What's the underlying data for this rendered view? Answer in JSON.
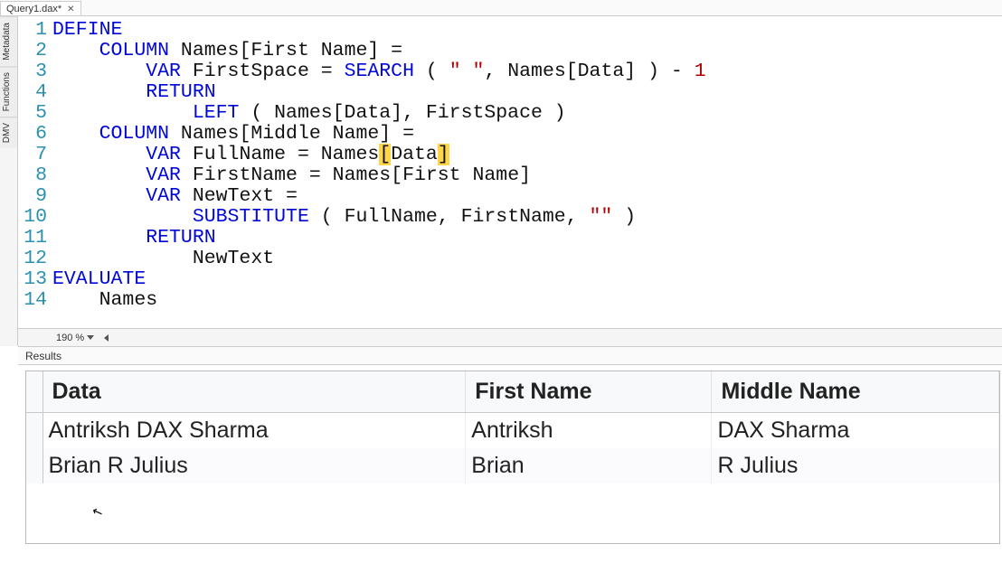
{
  "tab": {
    "title": "Query1.dax*"
  },
  "side_tabs": [
    "Metadata",
    "Functions",
    "DMV"
  ],
  "zoom": {
    "label": "190 %"
  },
  "code": {
    "lines": [
      [
        {
          "t": "DEFINE",
          "c": "kw"
        }
      ],
      [
        {
          "t": "    "
        },
        {
          "t": "COLUMN",
          "c": "kw"
        },
        {
          "t": " Names[First Name] ="
        }
      ],
      [
        {
          "t": "        "
        },
        {
          "t": "VAR",
          "c": "kw"
        },
        {
          "t": " FirstSpace = "
        },
        {
          "t": "SEARCH",
          "c": "fn"
        },
        {
          "t": " ( "
        },
        {
          "t": "\" \"",
          "c": "str"
        },
        {
          "t": ", Names[Data] ) - "
        },
        {
          "t": "1",
          "c": "num"
        }
      ],
      [
        {
          "t": "        "
        },
        {
          "t": "RETURN",
          "c": "kw"
        }
      ],
      [
        {
          "t": "            "
        },
        {
          "t": "LEFT",
          "c": "fn"
        },
        {
          "t": " ( Names[Data], FirstSpace )"
        }
      ],
      [
        {
          "t": "    "
        },
        {
          "t": "COLUMN",
          "c": "kw"
        },
        {
          "t": " Names[Middle Name] ="
        }
      ],
      [
        {
          "t": "        "
        },
        {
          "t": "VAR",
          "c": "kw"
        },
        {
          "t": " FullName = Names"
        },
        {
          "t": "[",
          "c": "hl"
        },
        {
          "t": "Data"
        },
        {
          "t": "]",
          "c": "hl"
        }
      ],
      [
        {
          "t": "        "
        },
        {
          "t": "VAR",
          "c": "kw"
        },
        {
          "t": " FirstName = Names[First Name]"
        }
      ],
      [
        {
          "t": "        "
        },
        {
          "t": "VAR",
          "c": "kw"
        },
        {
          "t": " NewText ="
        }
      ],
      [
        {
          "t": "            "
        },
        {
          "t": "SUBSTITUTE",
          "c": "fn"
        },
        {
          "t": " ( FullName, FirstName, "
        },
        {
          "t": "\"\"",
          "c": "str"
        },
        {
          "t": " )"
        }
      ],
      [
        {
          "t": "        "
        },
        {
          "t": "RETURN",
          "c": "kw"
        }
      ],
      [
        {
          "t": "            NewText"
        }
      ],
      [
        {
          "t": "EVALUATE",
          "c": "kw"
        }
      ],
      [
        {
          "t": "    Names"
        }
      ]
    ]
  },
  "results": {
    "panel_label": "Results",
    "headers": [
      "Data",
      "First Name",
      "Middle Name"
    ],
    "rows": [
      [
        "Antriksh DAX Sharma",
        "Antriksh",
        "DAX Sharma"
      ],
      [
        "Brian R Julius",
        "Brian",
        "R Julius"
      ]
    ]
  }
}
